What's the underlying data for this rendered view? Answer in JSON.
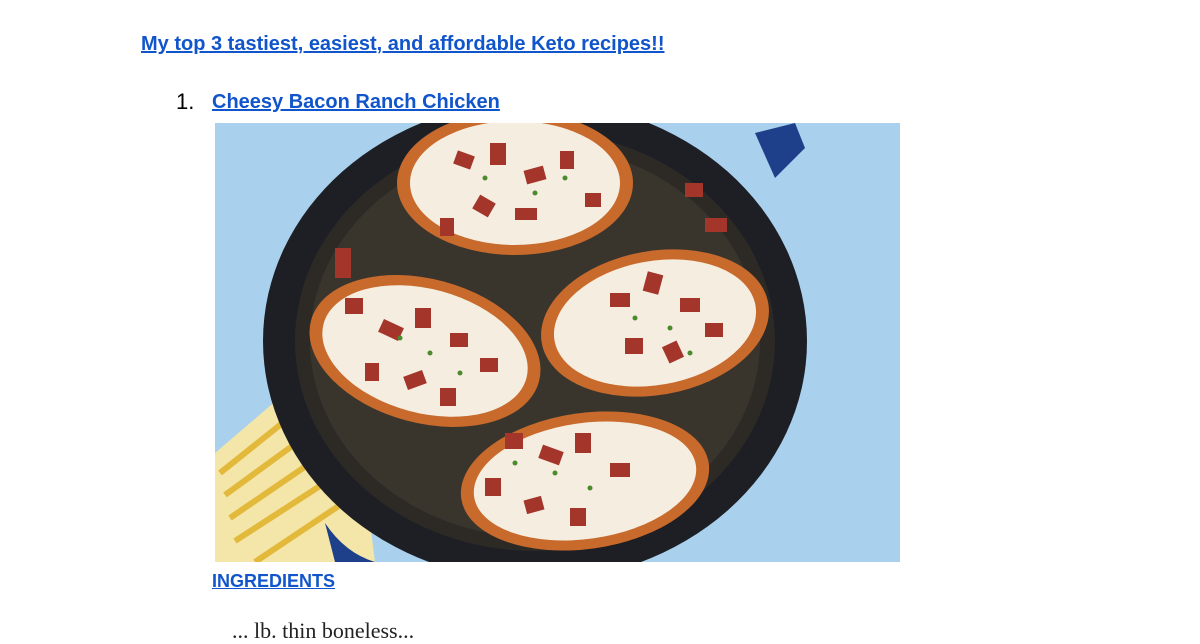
{
  "document": {
    "title": "My top 3 tastiest, easiest, and affordable Keto recipes!!",
    "recipes": [
      {
        "number": "1.",
        "name": "Cheesy Bacon Ranch Chicken",
        "ingredients_heading": "INGREDIENTS",
        "first_ingredient_partial": "... lb. thin boneless..."
      }
    ]
  },
  "colors": {
    "link": "#1155cc",
    "photo_background": "#a9d1ee",
    "skillet": "#1d1f24"
  }
}
